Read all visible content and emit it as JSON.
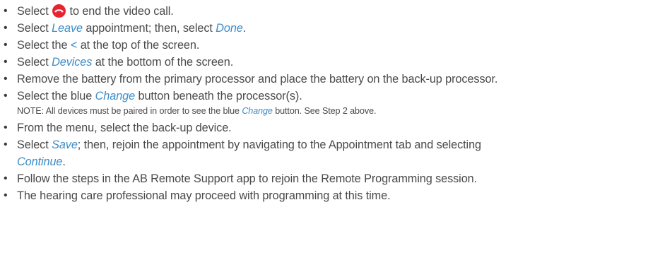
{
  "steps": [
    {
      "before": "Select ",
      "icon": "hang-up-icon",
      "after": " to end the video call."
    },
    {
      "pre": "Select ",
      "em1": "Leave",
      "mid": " appointment; then, select ",
      "em2": "Done",
      "post": "."
    },
    {
      "pre": "Select the ",
      "sym": "<",
      "post": " at the top of the screen."
    },
    {
      "pre": "Select ",
      "em": "Devices",
      "post": " at the bottom of the screen."
    },
    {
      "text": "Remove the battery from the primary processor and place the battery on the back-up processor."
    },
    {
      "pre": "Select the blue ",
      "em": "Change",
      "post": " button beneath the processor(s)."
    },
    {
      "note_pre": "NOTE: All devices must be paired in order to see the blue ",
      "note_em": "Change",
      "note_post": " button. See Step 2 above."
    },
    {
      "text": "From the menu, select the back-up device."
    },
    {
      "pre": "Select ",
      "em1": "Save",
      "mid": "; then, rejoin the appointment by navigating to the Appointment tab and selecting",
      "em2": "Continue",
      "post": "."
    },
    {
      "text": "Follow the steps in the AB Remote Support app to rejoin the Remote Programming session."
    },
    {
      "text": "The hearing care professional may proceed with programming at this time."
    }
  ],
  "bullet": "•",
  "colors": {
    "accent": "#3d8cc6",
    "text": "#4a4a4a",
    "hangup": "#e8232f"
  }
}
